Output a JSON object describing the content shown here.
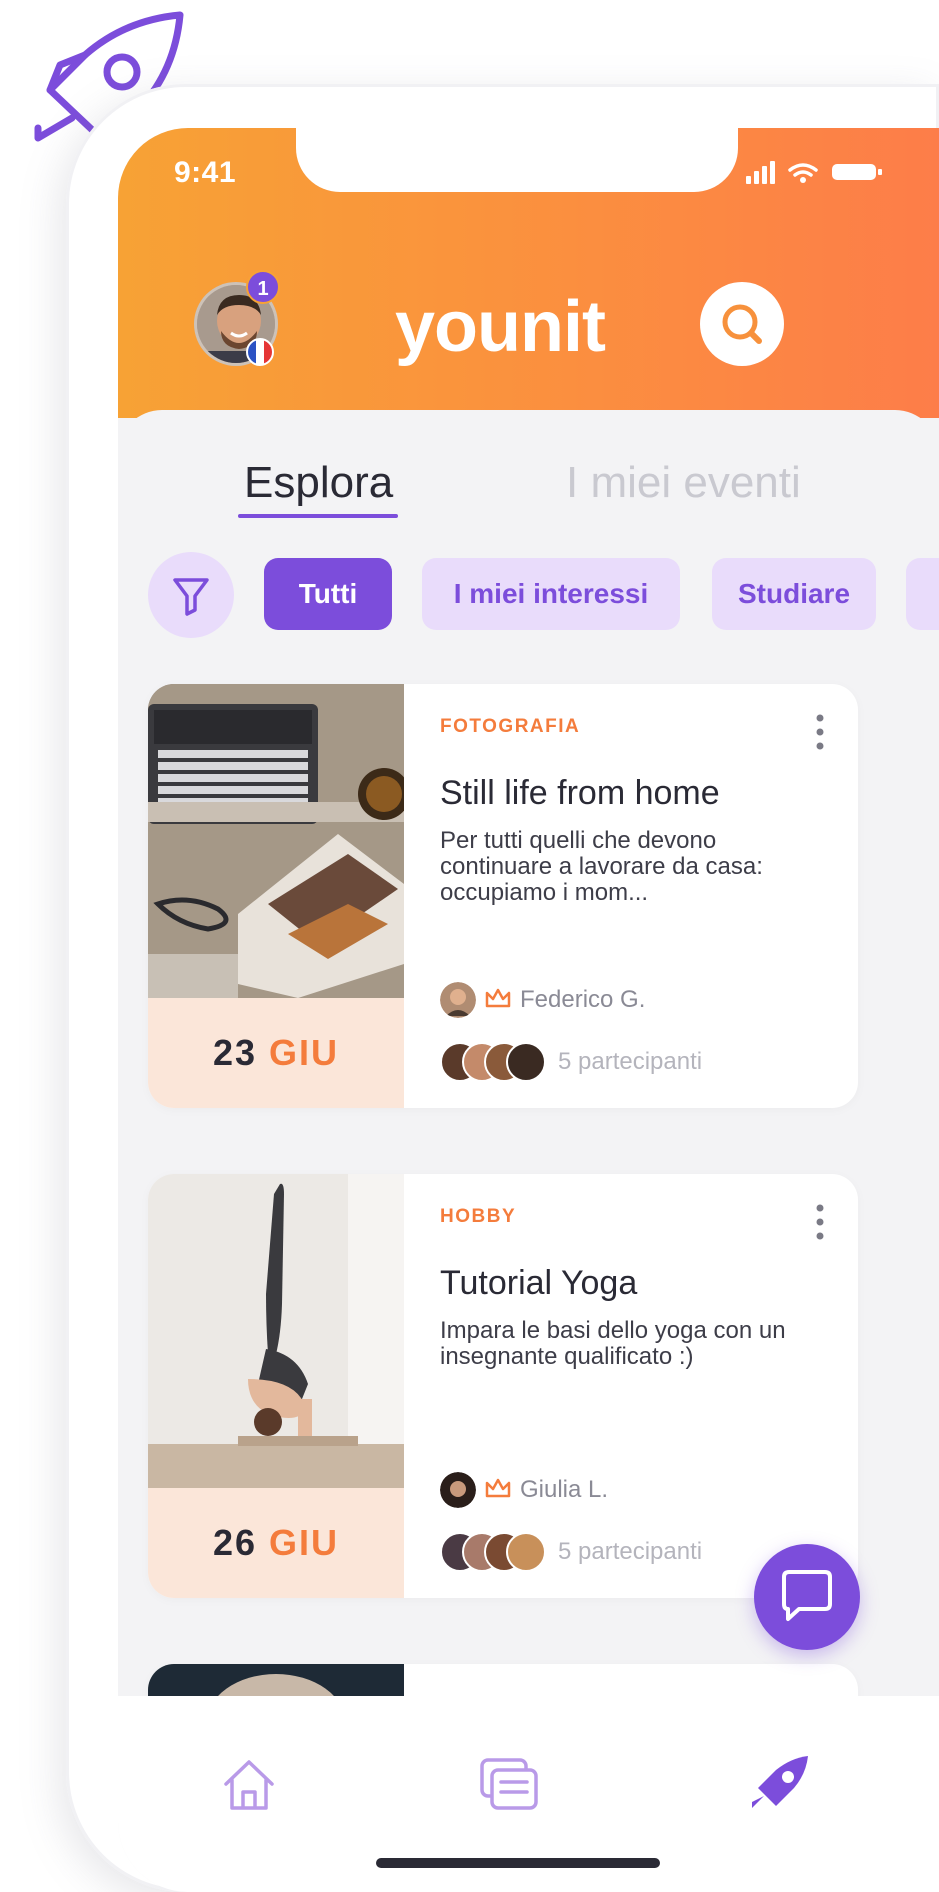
{
  "status_bar": {
    "time": "9:41"
  },
  "header": {
    "logo_text": "younit",
    "notification_count": "1"
  },
  "tabs": [
    {
      "label": "Esplora",
      "active": true
    },
    {
      "label": "I miei eventi",
      "active": false
    }
  ],
  "filters": {
    "chips": [
      {
        "label": "Tutti",
        "active": true
      },
      {
        "label": "I miei interessi",
        "active": false
      },
      {
        "label": "Studiare",
        "active": false
      }
    ]
  },
  "events": [
    {
      "category": "FOTOGRAFIA",
      "title": "Still life from home",
      "description": "Per tutti quelli che devono continuare a lavorare da casa: occupiamo i mom...",
      "day": "23",
      "month": "GIU",
      "host": "Federico G.",
      "participants": "5 partecipanti"
    },
    {
      "category": "HOBBY",
      "title": "Tutorial Yoga",
      "description": "Impara le basi dello yoga con un insegnante qualificato :)",
      "day": "26",
      "month": "GIU",
      "host": "Giulia L.",
      "participants": "5 partecipanti"
    }
  ],
  "colors": {
    "accent_purple": "#7c4ddb",
    "accent_orange": "#f47c3c",
    "header_gradient_start": "#f7a235",
    "header_gradient_end": "#fd7d49",
    "chip_bg": "#e9dcfb",
    "date_bg": "#fbe6d9"
  },
  "icons": {
    "decor": "rocket-icon",
    "search": "search-icon",
    "filter": "filter-icon",
    "more": "more-vertical-icon",
    "crown": "crown-icon",
    "chat": "chat-icon",
    "nav": [
      "home-icon",
      "messages-icon",
      "rocket-icon"
    ]
  }
}
